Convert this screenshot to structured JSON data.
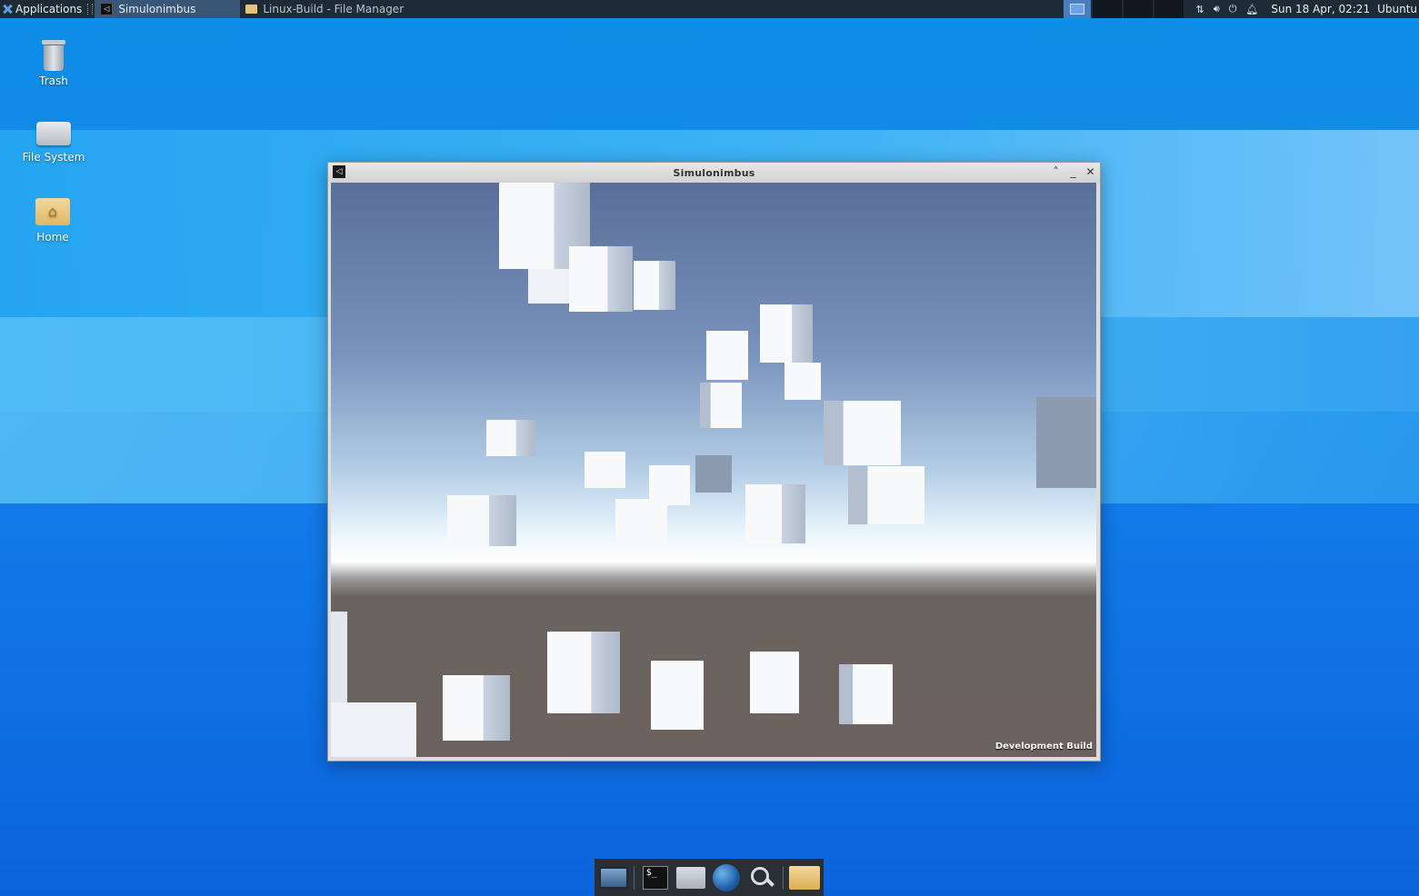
{
  "top_panel": {
    "applications_label": "Applications",
    "tasks": [
      {
        "label": "Simulonimbus",
        "active": true
      },
      {
        "label": "Linux-Build - File Manager",
        "active": false
      }
    ],
    "clock": "Sun 18 Apr, 02:21",
    "user": "Ubuntu",
    "tray_icons": [
      "network-icon",
      "volume-icon",
      "power-icon",
      "notification-bell-icon"
    ]
  },
  "desktop": {
    "icons": [
      {
        "label": "Trash",
        "icon": "trash-icon"
      },
      {
        "label": "File System",
        "icon": "drive-icon"
      },
      {
        "label": "Home",
        "icon": "home-folder-icon"
      }
    ]
  },
  "window": {
    "title": "Simulonimbus",
    "controls": [
      "maximize",
      "minimize",
      "close"
    ],
    "overlay_text": "Development Build"
  },
  "dock": {
    "items": [
      "show-desktop-icon",
      "terminal-icon",
      "file-manager-icon",
      "web-browser-icon",
      "app-finder-icon",
      "folder-icon"
    ]
  },
  "colors": {
    "panel_bg": "#1e2b36",
    "active_task_bg": "#3a5677",
    "desktop_blue": "#1679e8",
    "ground": "#6c625d"
  }
}
